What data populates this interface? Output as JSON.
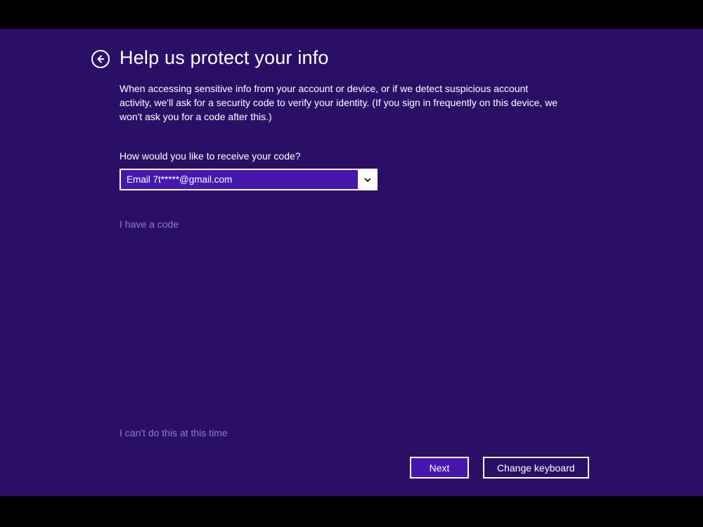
{
  "header": {
    "title": "Help us protect your info"
  },
  "body": {
    "description": "When accessing sensitive info from your account or device, or if we detect suspicious account activity, we'll ask for a security code to verify your identity. (If you sign in frequently on this device, we won't ask you for a code after this.)",
    "question": "How would you like to receive your code?",
    "dropdown_selected": "Email 7t*****@gmail.com",
    "have_code_link": "I have a code",
    "cant_do_link": "I can't do this at this time"
  },
  "buttons": {
    "next": "Next",
    "change_keyboard": "Change keyboard"
  }
}
